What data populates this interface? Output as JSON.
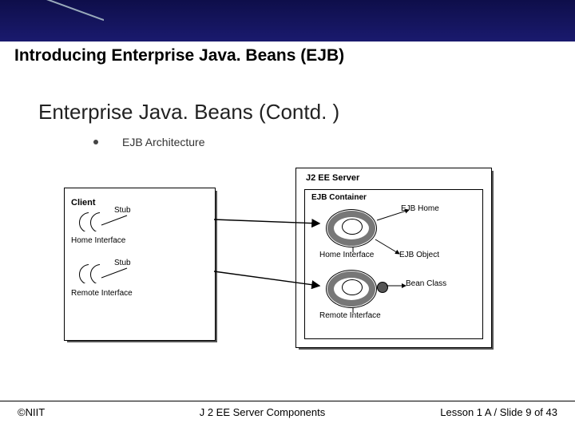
{
  "header": {
    "title": "Introducing Enterprise Java. Beans (EJB)"
  },
  "slide": {
    "subheading": "Enterprise Java. Beans (Contd. )",
    "bullet": "EJB Architecture"
  },
  "diagram": {
    "client": "Client",
    "stub": "Stub",
    "home_interface": "Home Interface",
    "remote_interface": "Remote Interface",
    "server": "J2 EE Server",
    "container": "EJB Container",
    "ejb_home": "EJB Home",
    "ejb_object": "EJB Object",
    "bean_class": "Bean Class"
  },
  "footer": {
    "left": "©NIIT",
    "center": "J 2 EE Server Components",
    "right": "Lesson 1 A / Slide 9 of 43"
  }
}
